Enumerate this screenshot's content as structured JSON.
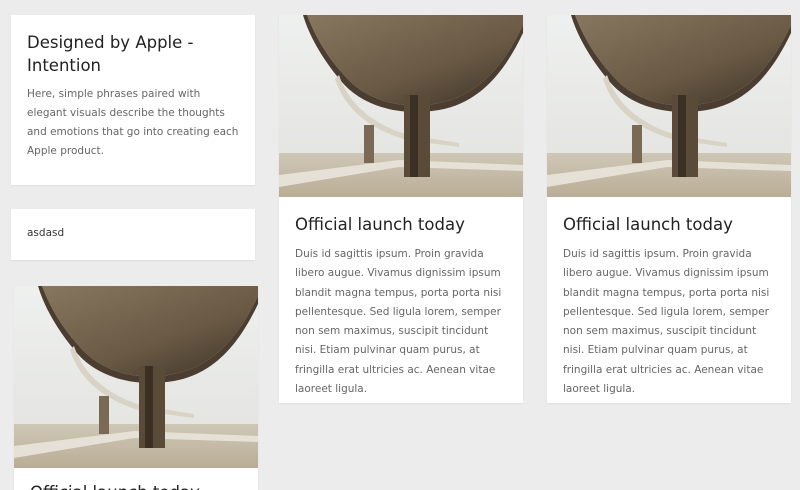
{
  "intro_card": {
    "title": "Designed by Apple - Intention",
    "body": "Here, simple phrases paired with elegant visuals describe the thoughts and emotions that go into creating each Apple product."
  },
  "mini_card": {
    "text": "asdasd"
  },
  "cards": [
    {
      "title": "Official launch today",
      "body": "Duis id sagittis ipsum. Proin gravida libero augue. Vivamus dignissim ipsum blandit magna tempus, porta porta nisi pellentesque. Sed ligula lorem, semper non sem maximus, suscipit tincidunt nisi. Etiam pulvinar quam purus, at fringilla erat ultricies ac. Aenean vitae laoreet ligula."
    },
    {
      "title": "Official launch today",
      "body": "Duis id sagittis ipsum. Proin gravida libero augue. Vivamus dignissim ipsum blandit magna tempus, porta porta nisi pellentesque. Sed ligula lorem, semper non sem maximus, suscipit tincidunt nisi. Etiam pulvinar quam purus, at fringilla erat ultricies ac. Aenean vitae laoreet ligula."
    },
    {
      "title": "Official launch today"
    }
  ],
  "colors": {
    "background": "#ececec",
    "card": "#ffffff",
    "title_text": "#222222",
    "body_text": "#666666"
  },
  "icons": {
    "card_image": "concrete-overpass-photo"
  }
}
